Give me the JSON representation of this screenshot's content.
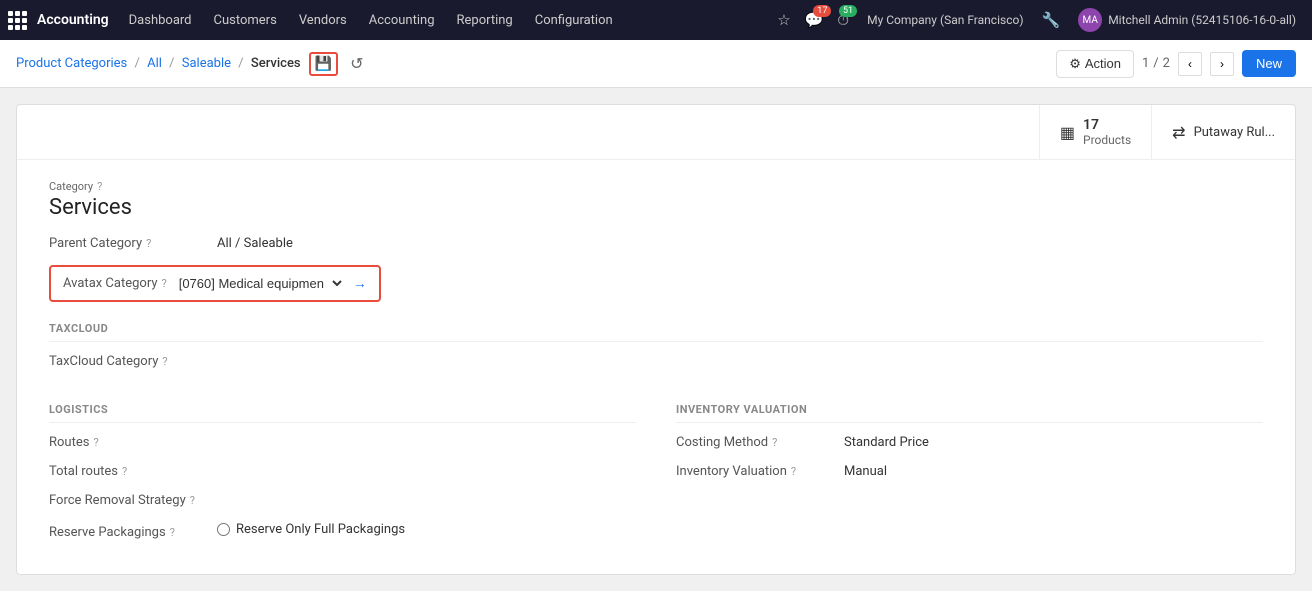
{
  "app": {
    "name": "Accounting",
    "logo_grid": true
  },
  "nav": {
    "items": [
      {
        "label": "Dashboard",
        "id": "dashboard"
      },
      {
        "label": "Customers",
        "id": "customers"
      },
      {
        "label": "Vendors",
        "id": "vendors"
      },
      {
        "label": "Accounting",
        "id": "accounting"
      },
      {
        "label": "Reporting",
        "id": "reporting"
      },
      {
        "label": "Configuration",
        "id": "configuration"
      }
    ],
    "icons": {
      "star": "☆",
      "chat": "💬",
      "chat_badge": "17",
      "activity": "⏱",
      "activity_badge": "51"
    },
    "company": "My Company (San Francisco)",
    "tools_icon": "🔧",
    "user": {
      "name": "Mitchell Admin (52415106-16-0-all)",
      "avatar_text": "MA"
    }
  },
  "breadcrumb": {
    "items": [
      {
        "label": "Product Categories",
        "link": true
      },
      {
        "label": "All",
        "link": true
      },
      {
        "label": "Saleable",
        "link": true
      },
      {
        "label": "Services",
        "link": false
      }
    ],
    "separator": "/",
    "save_icon": "💾",
    "reset_icon": "↺"
  },
  "toolbar": {
    "action_label": "Action",
    "gear_symbol": "⚙",
    "pager": {
      "current": "1",
      "total": "2"
    },
    "prev_icon": "‹",
    "next_icon": "›",
    "new_label": "New"
  },
  "header_buttons": {
    "products": {
      "icon": "▦",
      "count": "17",
      "label": "Products"
    },
    "putaway": {
      "icon": "⇄",
      "label": "Putaway Rul..."
    }
  },
  "form": {
    "category_label": "Category",
    "category_help": "?",
    "category_value": "Services",
    "parent_category_label": "Parent Category",
    "parent_category_help": "?",
    "parent_category_value": "All / Saleable",
    "avatax_label": "Avatax Category",
    "avatax_help": "?",
    "avatax_value": "[0760] Medical equipmen",
    "avatax_arrow": "→",
    "sections": {
      "taxcloud": {
        "title": "TAXCLOUD",
        "taxcloud_category_label": "TaxCloud Category",
        "taxcloud_category_help": "?"
      },
      "logistics": {
        "title": "LOGISTICS",
        "routes_label": "Routes",
        "routes_help": "?",
        "total_routes_label": "Total routes",
        "total_routes_help": "?",
        "force_removal_label": "Force Removal Strategy",
        "force_removal_help": "?",
        "reserve_packagings_label": "Reserve Packagings",
        "reserve_packagings_help": "?",
        "reserve_packagings_option": "Reserve Only Full Packagings"
      },
      "inventory_valuation": {
        "title": "INVENTORY VALUATION",
        "costing_method_label": "Costing Method",
        "costing_method_help": "?",
        "costing_method_value": "Standard Price",
        "inventory_valuation_label": "Inventory Valuation",
        "inventory_valuation_help": "?",
        "inventory_valuation_value": "Manual"
      }
    }
  }
}
